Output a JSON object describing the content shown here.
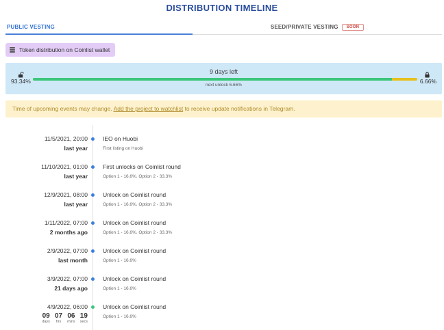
{
  "page_title": "DISTRIBUTION TIMELINE",
  "tabs": {
    "public": "PUBLIC VESTING",
    "seed": "SEED/PRIVATE VESTING",
    "seed_badge": "SOON"
  },
  "wallet_chip": {
    "label": "Token distribution on Coinlist wallet",
    "icon": "coins-icon"
  },
  "progress": {
    "unlocked_pct": "93.34%",
    "locked_pct": "6.66%",
    "unlocked_fraction": 0.9334,
    "days_left": "9 days left",
    "next_unlock": "next unlock 6.66%",
    "colors": {
      "unlocked": "#3cc67c",
      "locked": "#e6c11e"
    }
  },
  "notice": {
    "before": "Time of upcoming events may change.",
    "link": "Add the project to watchlist",
    "after": "to receive update notifications in Telegram."
  },
  "events": [
    {
      "date": "11/5/2021, 20:00",
      "relative": "last year",
      "title": "IEO on Huobi",
      "sub": "First listing on Huobi"
    },
    {
      "date": "11/10/2021, 01:00",
      "relative": "last year",
      "title": "First unlocks on Coinlist round",
      "sub": "Option 1 - 16.6%. Option 2 - 33.3%"
    },
    {
      "date": "12/9/2021, 08:00",
      "relative": "last year",
      "title": "Unlock on Coinlist round",
      "sub": "Option 1 - 16.6%. Option 2 - 33.3%"
    },
    {
      "date": "1/11/2022, 07:00",
      "relative": "2 months ago",
      "title": "Unlock on Coinlist round",
      "sub": "Option 1 - 16.6%. Option 2 - 33.3%"
    },
    {
      "date": "2/9/2022, 07:00",
      "relative": "last month",
      "title": "Unlock on Coinlist round",
      "sub": "Option 1 - 16.6%"
    },
    {
      "date": "3/9/2022, 07:00",
      "relative": "21 days ago",
      "title": "Unlock on Coinlist round",
      "sub": "Option 1 - 16.6%"
    },
    {
      "date": "4/9/2022, 06:00",
      "title": "Unlock on Coinlist round",
      "sub": "Option 1 - 16.6%"
    }
  ],
  "countdown": [
    {
      "value": "09",
      "unit": "days"
    },
    {
      "value": "07",
      "unit": "hrs"
    },
    {
      "value": "06",
      "unit": "mins"
    },
    {
      "value": "19",
      "unit": "secs"
    }
  ]
}
